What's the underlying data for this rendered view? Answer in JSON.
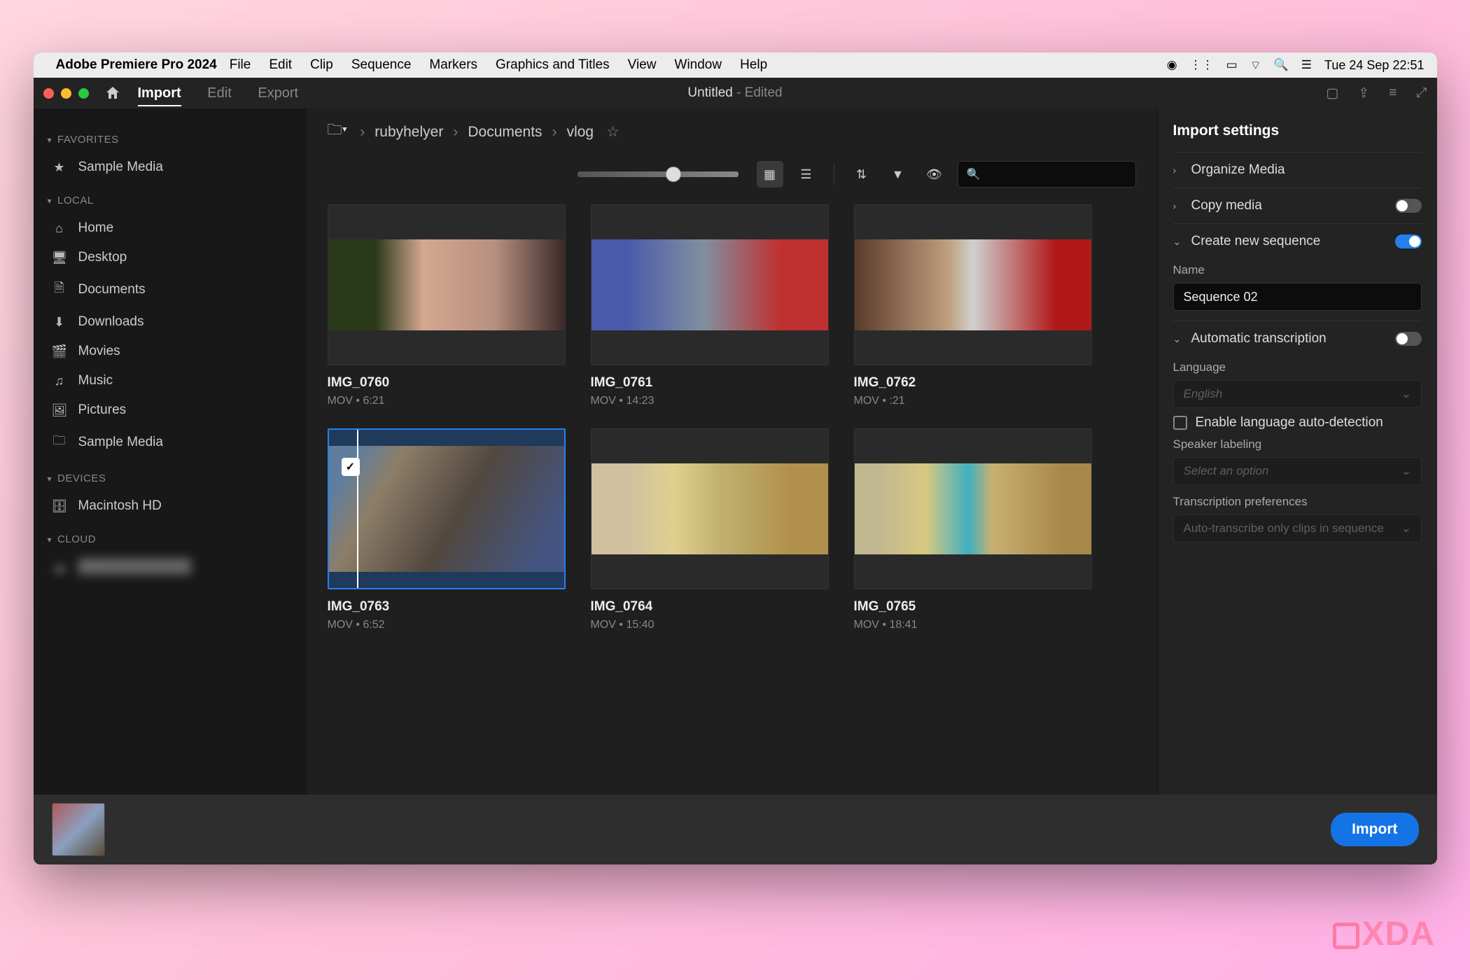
{
  "menubar": {
    "app_name": "Adobe Premiere Pro 2024",
    "items": [
      "File",
      "Edit",
      "Clip",
      "Sequence",
      "Markers",
      "Graphics and Titles",
      "View",
      "Window",
      "Help"
    ],
    "datetime": "Tue 24 Sep  22:51"
  },
  "titlebar": {
    "tabs": {
      "import": "Import",
      "edit": "Edit",
      "export": "Export"
    },
    "doc_title": "Untitled",
    "doc_state": " - Edited"
  },
  "sidebar": {
    "favorites_header": "FAVORITES",
    "favorites": [
      {
        "icon": "★",
        "label": "Sample Media"
      }
    ],
    "local_header": "LOCAL",
    "local": [
      {
        "icon": "home",
        "label": "Home"
      },
      {
        "icon": "desktop",
        "label": "Desktop"
      },
      {
        "icon": "document",
        "label": "Documents"
      },
      {
        "icon": "download",
        "label": "Downloads"
      },
      {
        "icon": "movie",
        "label": "Movies"
      },
      {
        "icon": "music",
        "label": "Music"
      },
      {
        "icon": "picture",
        "label": "Pictures"
      },
      {
        "icon": "folder",
        "label": "Sample Media"
      }
    ],
    "devices_header": "DEVICES",
    "devices": [
      {
        "icon": "disk",
        "label": "Macintosh HD"
      }
    ],
    "cloud_header": "CLOUD"
  },
  "breadcrumb": [
    "rubyhelyer",
    "Documents",
    "vlog"
  ],
  "clips": [
    {
      "name": "IMG_0760",
      "meta": "MOV  •  6:21",
      "selected": false
    },
    {
      "name": "IMG_0761",
      "meta": "MOV  •  14:23",
      "selected": false
    },
    {
      "name": "IMG_0762",
      "meta": "MOV  •  :21",
      "selected": false
    },
    {
      "name": "IMG_0763",
      "meta": "MOV  •  6:52",
      "selected": true
    },
    {
      "name": "IMG_0764",
      "meta": "MOV  •  15:40",
      "selected": false
    },
    {
      "name": "IMG_0765",
      "meta": "MOV  •  18:41",
      "selected": false
    }
  ],
  "settings": {
    "title": "Import settings",
    "organize": "Organize Media",
    "copy": "Copy media",
    "create_seq": "Create new sequence",
    "name_label": "Name",
    "seq_name": "Sequence 02",
    "auto_trans": "Automatic transcription",
    "lang_label": "Language",
    "lang_value": "English",
    "auto_detect": "Enable language auto-detection",
    "speaker_label": "Speaker labeling",
    "speaker_placeholder": "Select an option",
    "trans_pref_label": "Transcription preferences",
    "trans_pref_value": "Auto-transcribe only clips in sequence"
  },
  "footer": {
    "import": "Import"
  }
}
